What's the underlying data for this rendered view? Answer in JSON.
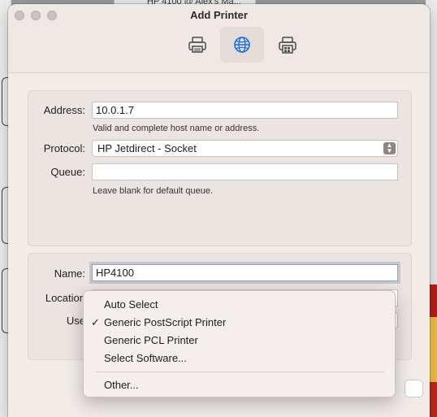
{
  "background": {
    "tab_text": "HP 4100 @ Alex's Ma..."
  },
  "window": {
    "title": "Add Printer",
    "toolbar": [
      {
        "name": "default-printer-icon",
        "active": false
      },
      {
        "name": "ip-globe-icon",
        "active": true
      },
      {
        "name": "windows-printer-icon",
        "active": false
      }
    ]
  },
  "address": {
    "label": "Address:",
    "value": "10.0.1.7",
    "hint": "Valid and complete host name or address."
  },
  "protocol": {
    "label": "Protocol:",
    "value": "HP Jetdirect - Socket"
  },
  "queue": {
    "label": "Queue:",
    "value": "",
    "hint": "Leave blank for default queue."
  },
  "name": {
    "label": "Name:",
    "value": "HP4100"
  },
  "location": {
    "label": "Location"
  },
  "use": {
    "label": "Use"
  },
  "menu": {
    "items": [
      {
        "label": "Auto Select",
        "checked": false
      },
      {
        "label": "Generic PostScript Printer",
        "checked": true
      },
      {
        "label": "Generic PCL Printer",
        "checked": false
      },
      {
        "label": "Select Software...",
        "checked": false
      },
      {
        "label": "Other...",
        "checked": false
      }
    ],
    "check_glyph": "✓"
  }
}
